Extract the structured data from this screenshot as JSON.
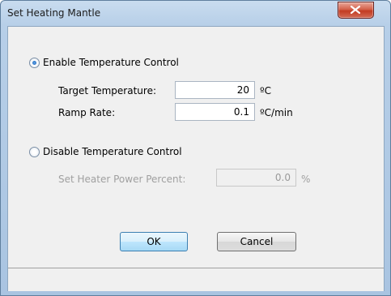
{
  "window": {
    "title": "Set Heating Mantle"
  },
  "enable_control": {
    "label": "Enable Temperature Control",
    "selected": true
  },
  "target_temperature": {
    "label": "Target Temperature:",
    "value": "20",
    "unit": "ºC"
  },
  "ramp_rate": {
    "label": "Ramp Rate:",
    "value": "0.1",
    "unit": "ºC/min"
  },
  "disable_control": {
    "label": "Disable Temperature Control",
    "selected": false
  },
  "heater_power": {
    "label": "Set Heater Power Percent:",
    "value": "0.0",
    "unit": "%"
  },
  "buttons": {
    "ok": "OK",
    "cancel": "Cancel"
  },
  "icons": {
    "close": "close-icon"
  },
  "colors": {
    "title_bar": "#b7cfe8",
    "close_button": "#c23b22",
    "dialog_bg": "#f0f0f0",
    "default_button": "#bee6fd"
  }
}
